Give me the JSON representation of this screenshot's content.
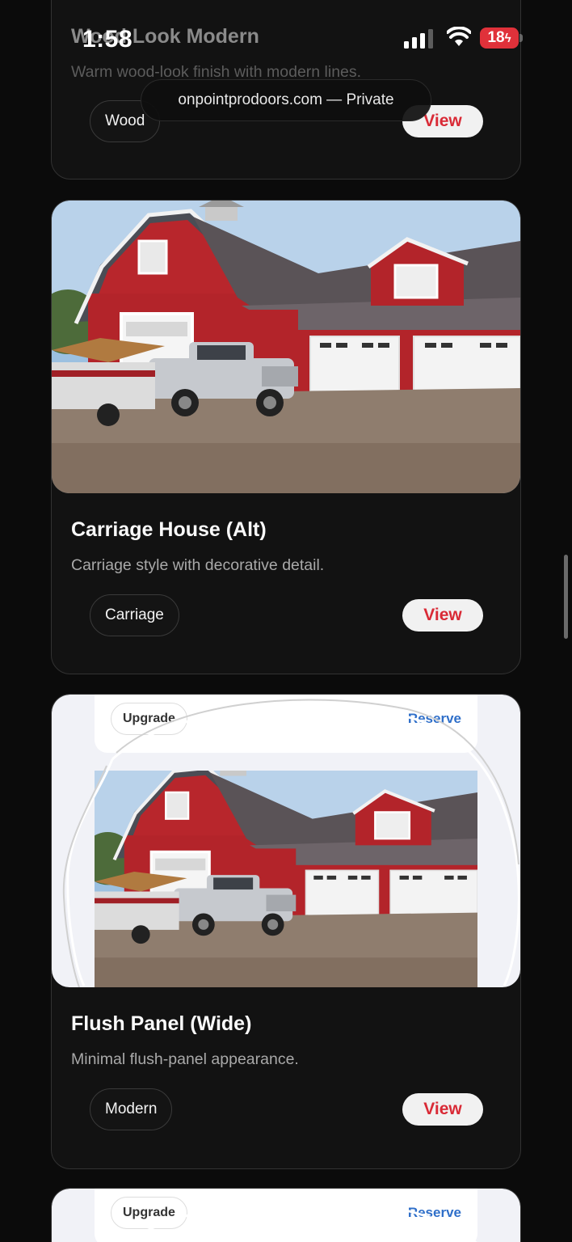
{
  "status_bar": {
    "time": "1:58",
    "battery": "18"
  },
  "browser": {
    "url": "onpointprodoors.com — Private"
  },
  "cards": [
    {
      "title": "Wood Look Modern",
      "description": "Warm wood-look finish with modern lines.",
      "tag": "Wood",
      "button": "View"
    },
    {
      "title": "Carriage House (Alt)",
      "description": "Carriage style with decorative detail.",
      "tag": "Carriage",
      "button": "View"
    },
    {
      "title": "Flush Panel (Wide)",
      "description": "Minimal flush-panel appearance.",
      "tag": "Modern",
      "button": "View",
      "image_overlay": {
        "tag": "Upgrade",
        "action": "Reserve"
      }
    },
    {
      "image_overlay": {
        "tag": "Upgrade",
        "action": "Reserve"
      }
    }
  ],
  "colors": {
    "accent": "#d92a36",
    "link": "#2f6fc9",
    "background": "#0b0b0b"
  }
}
